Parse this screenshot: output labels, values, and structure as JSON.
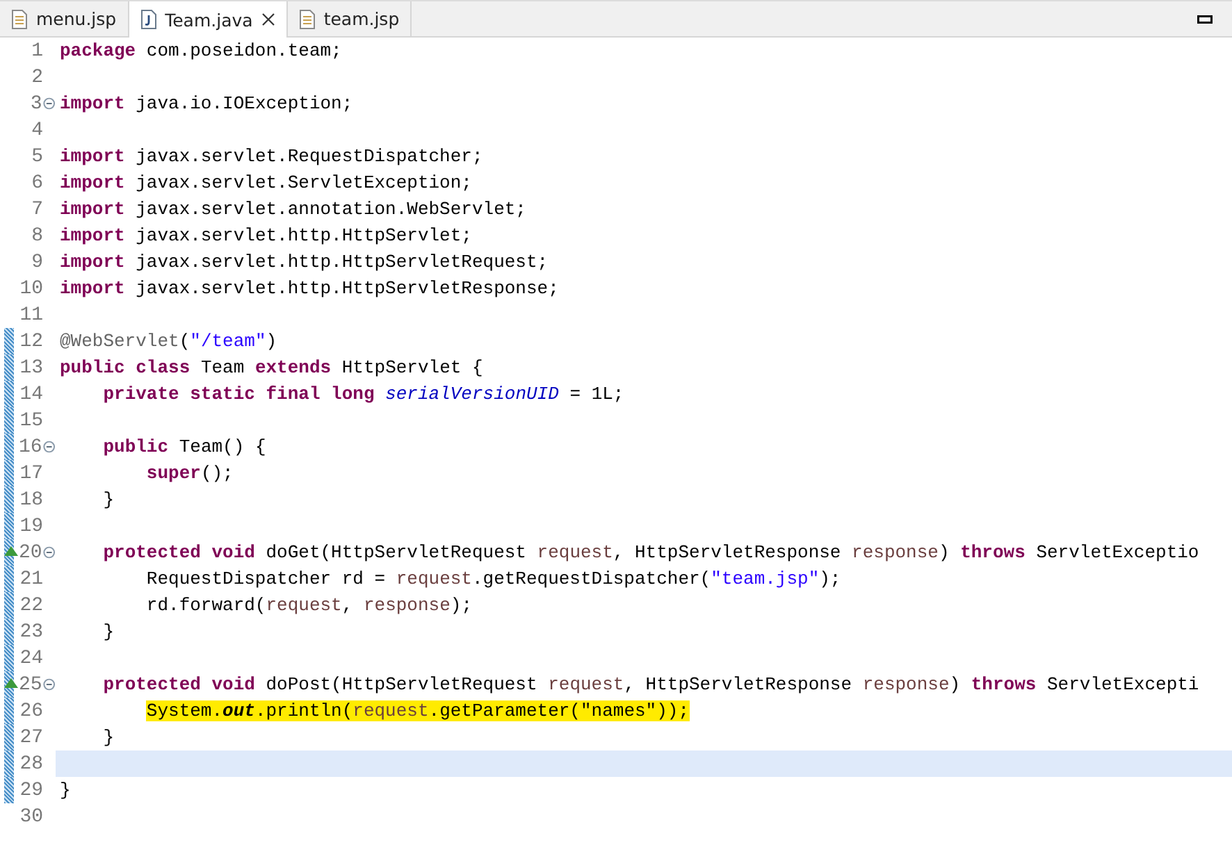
{
  "tabs": [
    {
      "label": "menu.jsp",
      "kind": "jsp",
      "selected": false
    },
    {
      "label": "Team.java",
      "kind": "java",
      "selected": true
    },
    {
      "label": "team.jsp",
      "kind": "jsp",
      "selected": false
    }
  ],
  "lines": [
    {
      "number": "1",
      "fold": false,
      "override": false,
      "changed": false,
      "current": false,
      "highlighted": false,
      "tokens": [
        {
          "kind": "kw",
          "text": "package"
        },
        {
          "kind": "plain",
          "text": " com.poseidon.team;"
        }
      ]
    },
    {
      "number": "2",
      "fold": false,
      "override": false,
      "changed": false,
      "current": false
    },
    {
      "number": "3",
      "fold": true,
      "override": false,
      "changed": false,
      "current": false,
      "highlighted": false,
      "tokens": [
        {
          "kind": "kw",
          "text": "import"
        },
        {
          "kind": "plain",
          "text": " java.io.IOException;"
        }
      ]
    },
    {
      "number": "4",
      "fold": false,
      "override": false,
      "changed": false,
      "current": false
    },
    {
      "number": "5",
      "fold": false,
      "override": false,
      "changed": false,
      "current": false,
      "highlighted": false,
      "tokens": [
        {
          "kind": "kw",
          "text": "import"
        },
        {
          "kind": "plain",
          "text": " javax.servlet.RequestDispatcher;"
        }
      ]
    },
    {
      "number": "6",
      "fold": false,
      "override": false,
      "changed": false,
      "current": false,
      "highlighted": false,
      "tokens": [
        {
          "kind": "kw",
          "text": "import"
        },
        {
          "kind": "plain",
          "text": " javax.servlet.ServletException;"
        }
      ]
    },
    {
      "number": "7",
      "fold": false,
      "override": false,
      "changed": false,
      "current": false,
      "highlighted": false,
      "tokens": [
        {
          "kind": "kw",
          "text": "import"
        },
        {
          "kind": "plain",
          "text": " javax.servlet.annotation.WebServlet;"
        }
      ]
    },
    {
      "number": "8",
      "fold": false,
      "override": false,
      "changed": false,
      "current": false,
      "highlighted": false,
      "tokens": [
        {
          "kind": "kw",
          "text": "import"
        },
        {
          "kind": "plain",
          "text": " javax.servlet.http.HttpServlet;"
        }
      ]
    },
    {
      "number": "9",
      "fold": false,
      "override": false,
      "changed": false,
      "current": false,
      "highlighted": false,
      "tokens": [
        {
          "kind": "kw",
          "text": "import"
        },
        {
          "kind": "plain",
          "text": " javax.servlet.http.HttpServletRequest;"
        }
      ]
    },
    {
      "number": "10",
      "fold": false,
      "override": false,
      "changed": false,
      "current": false,
      "highlighted": false,
      "tokens": [
        {
          "kind": "kw",
          "text": "import"
        },
        {
          "kind": "plain",
          "text": " javax.servlet.http.HttpServletResponse;"
        }
      ]
    },
    {
      "number": "11",
      "fold": false,
      "override": false,
      "changed": false,
      "current": false
    },
    {
      "number": "12",
      "fold": false,
      "override": false,
      "changed": true,
      "current": false,
      "highlighted": false,
      "tokens": [
        {
          "kind": "ann",
          "text": "@WebServlet"
        },
        {
          "kind": "plain",
          "text": "("
        },
        {
          "kind": "str",
          "text": "\"/team\""
        },
        {
          "kind": "plain",
          "text": ")"
        }
      ]
    },
    {
      "number": "13",
      "fold": false,
      "override": false,
      "changed": true,
      "current": false,
      "highlighted": false,
      "tokens": [
        {
          "kind": "kw",
          "text": "public class"
        },
        {
          "kind": "plain",
          "text": " Team "
        },
        {
          "kind": "kw",
          "text": "extends"
        },
        {
          "kind": "plain",
          "text": " HttpServlet {"
        }
      ]
    },
    {
      "number": "14",
      "fold": false,
      "override": false,
      "changed": true,
      "current": false,
      "highlighted": false,
      "tokens": [
        {
          "kind": "kw",
          "text": "    private static final long"
        },
        {
          "kind": "constant",
          "text": " serialVersionUID"
        },
        {
          "kind": "plain",
          "text": " = 1L;"
        }
      ]
    },
    {
      "number": "15",
      "fold": false,
      "override": false,
      "changed": true,
      "current": false
    },
    {
      "number": "16",
      "fold": true,
      "override": false,
      "changed": true,
      "current": false,
      "highlighted": false,
      "tokens": [
        {
          "kind": "kw",
          "text": "    public"
        },
        {
          "kind": "plain",
          "text": " Team() {"
        }
      ]
    },
    {
      "number": "17",
      "fold": false,
      "override": false,
      "changed": true,
      "current": false,
      "highlighted": false,
      "tokens": [
        {
          "kind": "kw",
          "text": "        super"
        },
        {
          "kind": "plain",
          "text": "();"
        }
      ]
    },
    {
      "number": "18",
      "fold": false,
      "override": false,
      "changed": true,
      "current": false,
      "highlighted": false,
      "tokens": [
        {
          "kind": "plain",
          "text": "    }"
        }
      ]
    },
    {
      "number": "19",
      "fold": false,
      "override": false,
      "changed": true,
      "current": false
    },
    {
      "number": "20",
      "fold": true,
      "override": true,
      "changed": true,
      "current": false,
      "highlighted": false,
      "tokens": [
        {
          "kind": "kw",
          "text": "    protected void"
        },
        {
          "kind": "plain",
          "text": " doGet(HttpServletRequest "
        },
        {
          "kind": "param",
          "text": "request"
        },
        {
          "kind": "plain",
          "text": ", HttpServletResponse "
        },
        {
          "kind": "param",
          "text": "response"
        },
        {
          "kind": "plain",
          "text": ") "
        },
        {
          "kind": "kw",
          "text": "throws"
        },
        {
          "kind": "plain",
          "text": " ServletExceptio"
        }
      ]
    },
    {
      "number": "21",
      "fold": false,
      "override": false,
      "changed": true,
      "current": false,
      "highlighted": false,
      "tokens": [
        {
          "kind": "plain",
          "text": "        RequestDispatcher rd = "
        },
        {
          "kind": "param",
          "text": "request"
        },
        {
          "kind": "plain",
          "text": ".getRequestDispatcher("
        },
        {
          "kind": "str",
          "text": "\"team.jsp\""
        },
        {
          "kind": "plain",
          "text": ");"
        }
      ]
    },
    {
      "number": "22",
      "fold": false,
      "override": false,
      "changed": true,
      "current": false,
      "highlighted": false,
      "tokens": [
        {
          "kind": "plain",
          "text": "        rd.forward("
        },
        {
          "kind": "param",
          "text": "request"
        },
        {
          "kind": "plain",
          "text": ", "
        },
        {
          "kind": "param",
          "text": "response"
        },
        {
          "kind": "plain",
          "text": ");"
        }
      ]
    },
    {
      "number": "23",
      "fold": false,
      "override": false,
      "changed": true,
      "current": false,
      "highlighted": false,
      "tokens": [
        {
          "kind": "plain",
          "text": "    }"
        }
      ]
    },
    {
      "number": "24",
      "fold": false,
      "override": false,
      "changed": true,
      "current": false
    },
    {
      "number": "25",
      "fold": true,
      "override": true,
      "changed": true,
      "current": false,
      "highlighted": false,
      "tokens": [
        {
          "kind": "kw",
          "text": "    protected void"
        },
        {
          "kind": "plain",
          "text": " doPost(HttpServletRequest "
        },
        {
          "kind": "param",
          "text": "request"
        },
        {
          "kind": "plain",
          "text": ", HttpServletResponse "
        },
        {
          "kind": "param",
          "text": "response"
        },
        {
          "kind": "plain",
          "text": ") "
        },
        {
          "kind": "kw",
          "text": "throws"
        },
        {
          "kind": "plain",
          "text": " ServletExcepti"
        }
      ]
    },
    {
      "number": "26",
      "fold": false,
      "override": false,
      "changed": true,
      "current": false,
      "highlighted": true,
      "tokens": [
        {
          "kind": "plain",
          "text": "        System."
        },
        {
          "kind": "static",
          "text": "out"
        },
        {
          "kind": "plain",
          "text": ".println("
        },
        {
          "kind": "param",
          "text": "request"
        },
        {
          "kind": "plain",
          "text": ".getParameter(\"names\"));"
        }
      ]
    },
    {
      "number": "27",
      "fold": false,
      "override": false,
      "changed": true,
      "current": false,
      "highlighted": false,
      "tokens": [
        {
          "kind": "plain",
          "text": "    }"
        }
      ]
    },
    {
      "number": "28",
      "fold": false,
      "override": false,
      "changed": true,
      "current": true
    },
    {
      "number": "29",
      "fold": false,
      "override": false,
      "changed": true,
      "current": false,
      "highlighted": false,
      "tokens": [
        {
          "kind": "plain",
          "text": "}"
        }
      ]
    },
    {
      "number": "30",
      "fold": false,
      "override": false,
      "changed": false,
      "current": false
    }
  ]
}
